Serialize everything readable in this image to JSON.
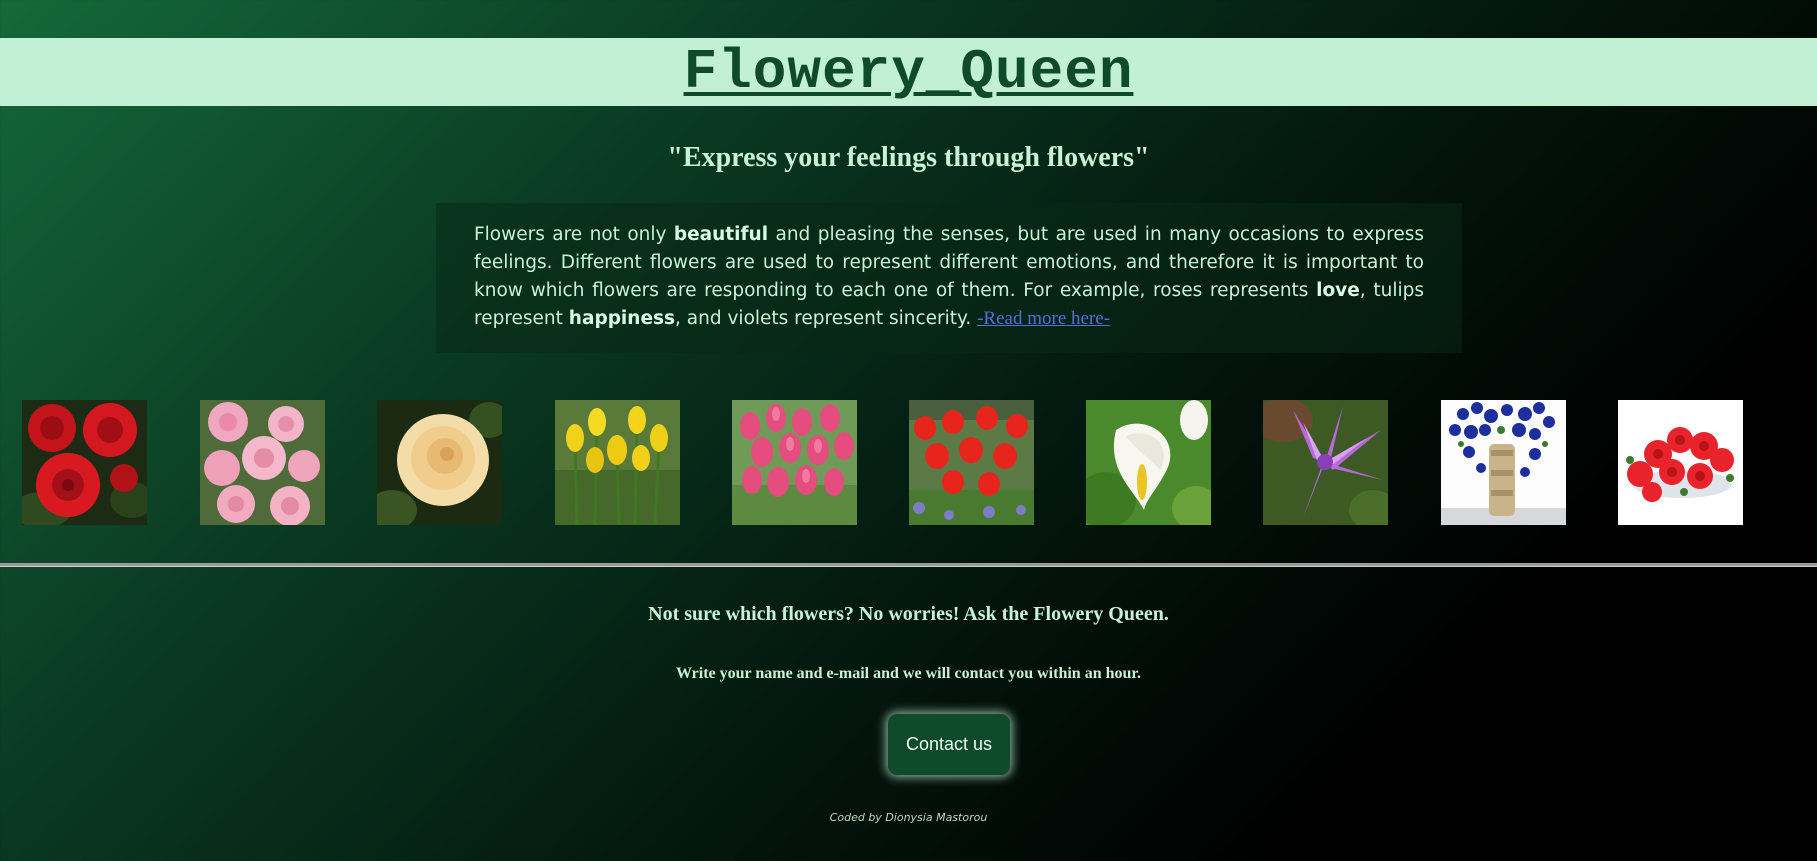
{
  "header": {
    "title": "Flowery_Queen",
    "tagline": "\"Express your feelings through flowers\""
  },
  "intro": {
    "part1": "Flowers are not only ",
    "bold_beautiful": "beautiful",
    "part2": " and pleasing the senses, but are used in many occasions to express feelings. Different flowers are used to represent different emotions, and therefore it is important to know which flowers are responding to each one of them. For example, roses represents ",
    "bold_love": "love",
    "part3": ", tulips represent ",
    "bold_happiness": "happiness",
    "part4": ", and violets represent sincerity. ",
    "read_more": "-Read more here-"
  },
  "gallery": {
    "images": [
      {
        "icon": "red-roses-icon"
      },
      {
        "icon": "pink-roses-icon"
      },
      {
        "icon": "cream-rose-icon"
      },
      {
        "icon": "yellow-tulips-icon"
      },
      {
        "icon": "pink-tulips-icon"
      },
      {
        "icon": "red-tulips-icon"
      },
      {
        "icon": "white-calla-lily-icon"
      },
      {
        "icon": "purple-lily-icon"
      },
      {
        "icon": "blue-flower-vase-icon"
      },
      {
        "icon": "red-carnations-icon"
      }
    ]
  },
  "cta": {
    "heading": "Not sure which flowers? No worries! Ask the Flowery Queen.",
    "subheading": "Write your name and e-mail and we will contact you within an hour.",
    "button": "Contact us"
  },
  "footer": {
    "credit": "Coded by Dionysia Mastorou"
  },
  "colors": {
    "title_bar_bg": "#c2f0d4",
    "title_text": "#0f4a2a",
    "body_text": "#c6f2d6",
    "link": "#4f6fe0",
    "button_bg": "#0f4a2a",
    "gradient_start": "#14693a",
    "gradient_end": "#000000"
  }
}
